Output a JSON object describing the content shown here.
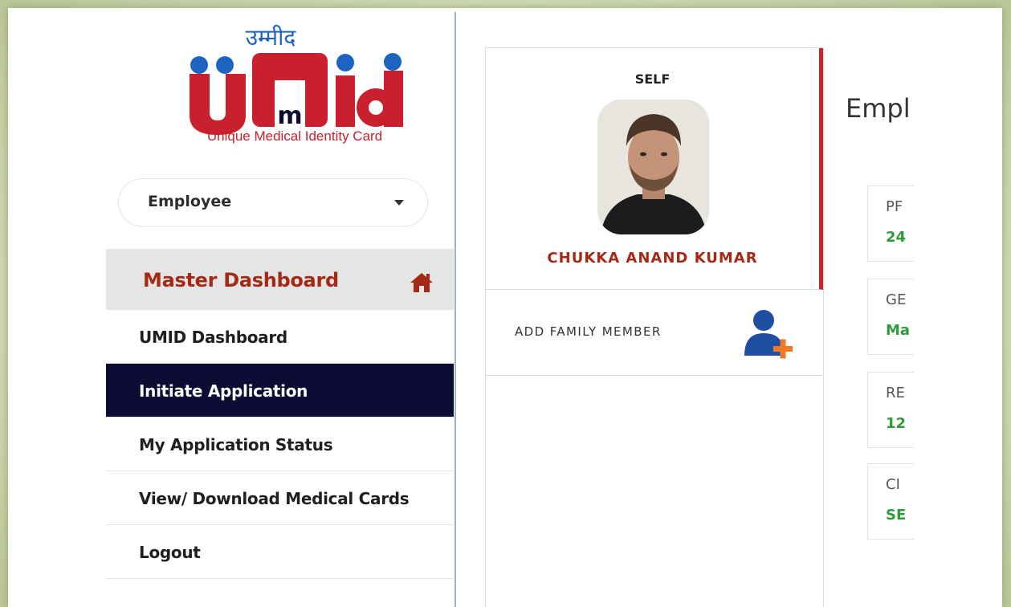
{
  "logo": {
    "hindi_text": "उम्मीद",
    "wordmark_left": "U",
    "wordmark_m": "m",
    "wordmark_right": "id",
    "tagline": "Unique Medical Identity Card",
    "brand_red": "#c8202c",
    "brand_blue": "#1e63c2"
  },
  "role_select": {
    "value": "Employee"
  },
  "nav": {
    "master": "Master Dashboard",
    "items": [
      {
        "label": "UMID Dashboard"
      },
      {
        "label": "Initiate Application"
      },
      {
        "label": "My Application Status"
      },
      {
        "label": "View/ Download Medical Cards"
      },
      {
        "label": "Logout"
      }
    ]
  },
  "member": {
    "relation": "SELF",
    "name": "CHUKKA ANAND KUMAR",
    "add_family_label": "ADD FAMILY MEMBER"
  },
  "details": {
    "title": "Empl",
    "fields": [
      {
        "label": "PF",
        "value": "24"
      },
      {
        "label": "GE",
        "value": "Ma"
      },
      {
        "label": "RE",
        "value": "12"
      },
      {
        "label": "CI",
        "value": "SE"
      }
    ]
  },
  "colors": {
    "accent_red": "#a52a16",
    "active_nav": "#0b0b33",
    "value_green": "#2e9a3a",
    "card_border_red": "#d5202a"
  }
}
